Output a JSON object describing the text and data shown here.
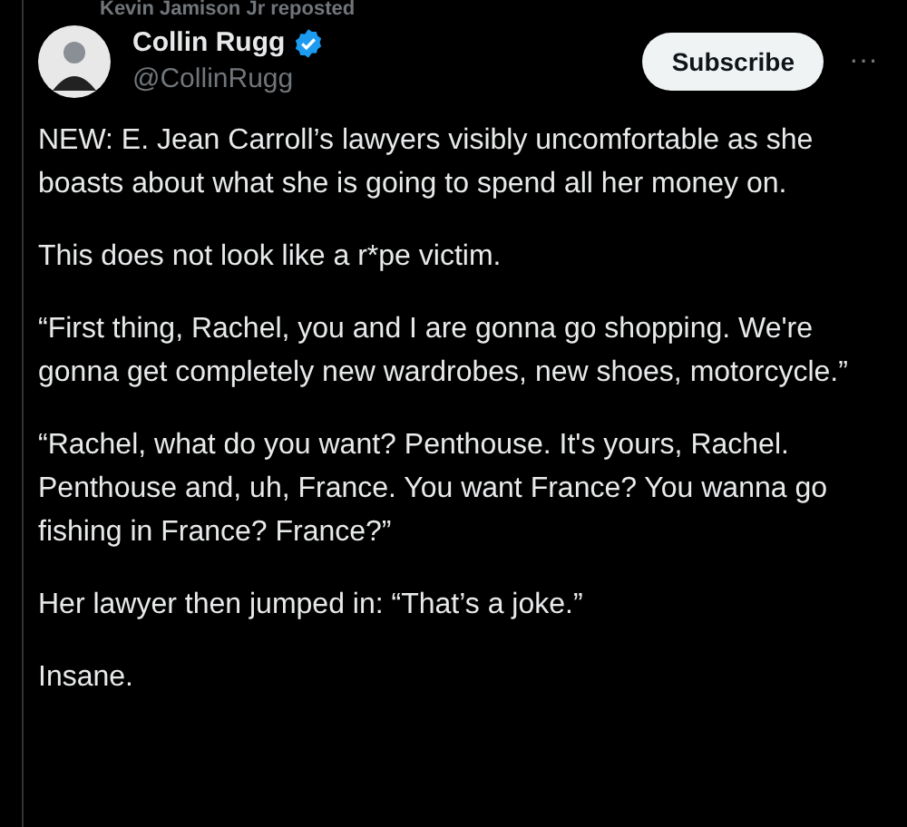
{
  "repost": {
    "text": "Kevin Jamison Jr reposted"
  },
  "author": {
    "name": "Collin Rugg",
    "handle": "@CollinRugg",
    "verified": true
  },
  "subscribe_button": "Subscribe",
  "more_button": "···",
  "paragraphs": [
    "NEW: E. Jean Carroll’s lawyers visibly uncomfortable as she boasts about what she is going to spend all her money on.",
    "This does not look like a r*pe victim.",
    "“First thing, Rachel, you and I are gonna go shopping. We're gonna get completely new wardrobes, new shoes, motorcycle.”",
    "“Rachel, what do you want? Penthouse. It's yours, Rachel. Penthouse and, uh, France. You want France? You wanna go fishing in France? France?”",
    "Her lawyer then jumped in: “That’s a joke.”",
    "Insane."
  ]
}
